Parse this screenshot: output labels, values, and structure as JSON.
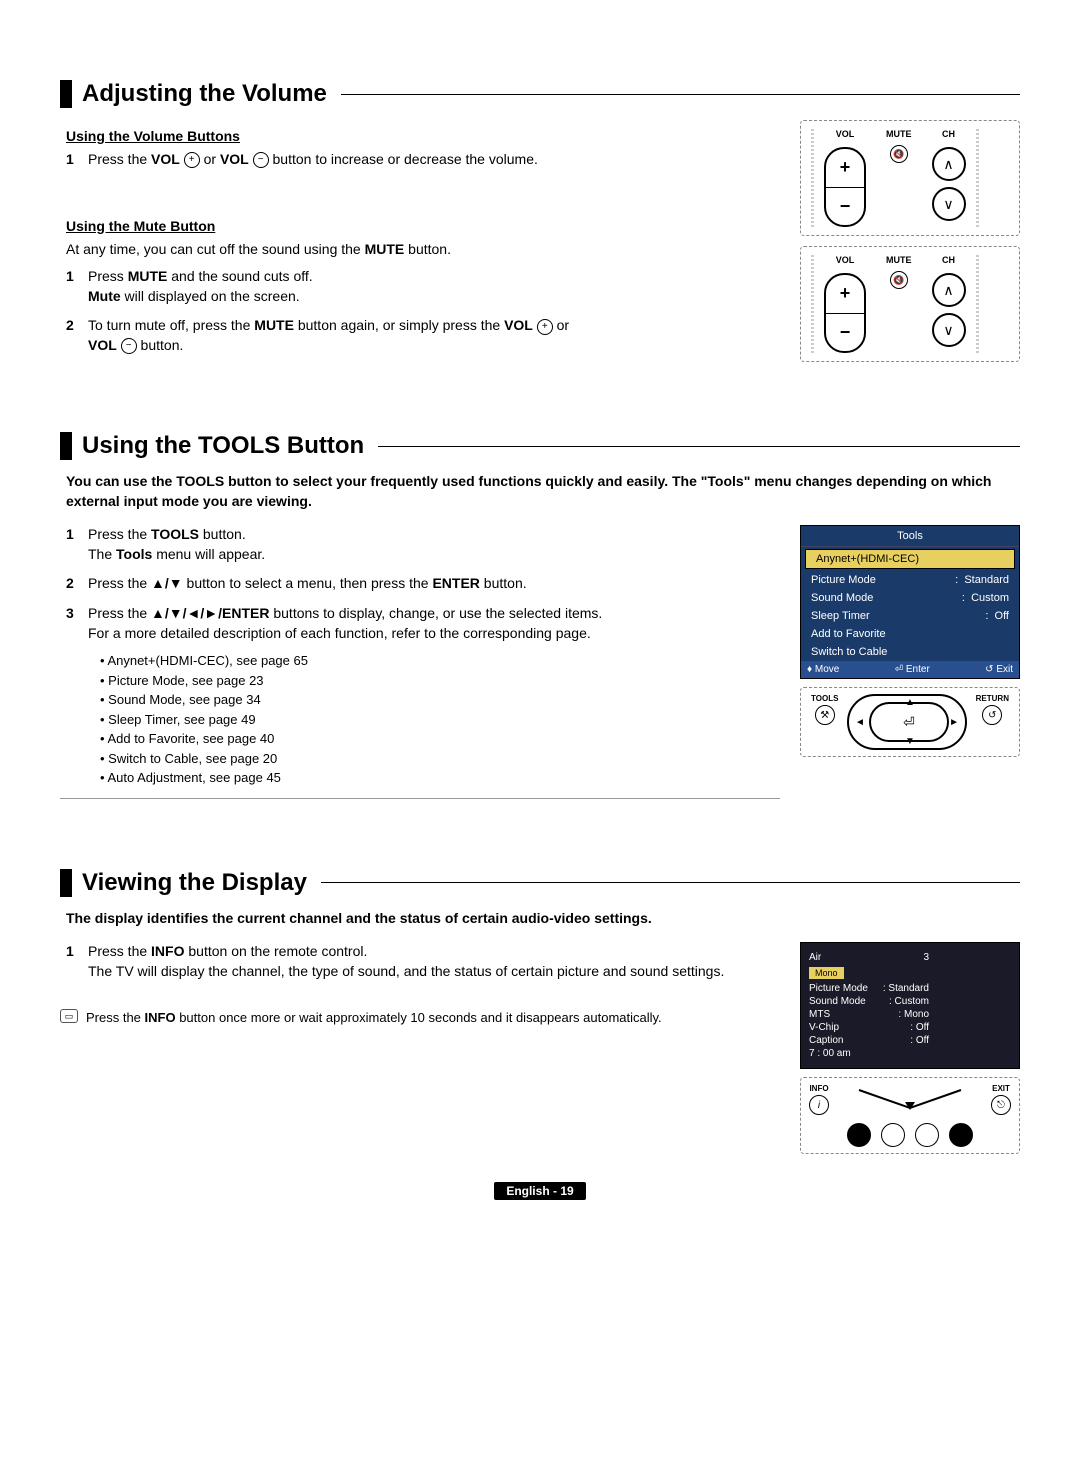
{
  "sections": {
    "volume": {
      "title": "Adjusting the Volume",
      "sub1": "Using the Volume Buttons",
      "step1_pre": "Press the ",
      "step1_b1": "VOL",
      "step1_mid": " or ",
      "step1_b2": "VOL",
      "step1_post": " button to increase or decrease the volume.",
      "sub2": "Using the Mute Button",
      "mute_intro_pre": "At any time, you can cut off the sound using the ",
      "mute_intro_b": "MUTE",
      "mute_intro_post": " button.",
      "m1_pre": "Press ",
      "m1_b": "MUTE",
      "m1_mid": " and the sound cuts off.",
      "m1_line2_b": "Mute",
      "m1_line2": " will displayed on the screen.",
      "m2_pre": "To turn mute off, press the ",
      "m2_b1": "MUTE",
      "m2_mid": " button again, or simply press the ",
      "m2_b2": "VOL",
      "m2_or": " or ",
      "m2_b3": "VOL",
      "m2_post": " button.",
      "fig": {
        "vol": "VOL",
        "ch": "CH",
        "mute": "MUTE"
      }
    },
    "tools": {
      "title": "Using the TOOLS Button",
      "intro": "You can use the TOOLS button to select your frequently used functions quickly and easily. The \"Tools\" menu changes depending on which external input mode you are viewing.",
      "s1_pre": "Press the ",
      "s1_b": "TOOLS",
      "s1_post": " button.",
      "s1_line2_pre": "The ",
      "s1_line2_b": "Tools",
      "s1_line2_post": " menu will appear.",
      "s2_pre": "Press the ",
      "s2_b": "▲/▼",
      "s2_mid": " button to select a menu, then press the ",
      "s2_b2": "ENTER",
      "s2_post": " button.",
      "s3_pre": "Press the ",
      "s3_b": "▲/▼/◄/►/ENTER",
      "s3_post": " buttons to display, change, or use the selected items.",
      "s3_line2": "For a more detailed description of each function, refer to the corresponding page.",
      "bullets": [
        "• Anynet+(HDMI-CEC), see page 65",
        "• Picture Mode, see page 23",
        "• Sound Mode, see page 34",
        "• Sleep Timer, see page 49",
        "• Add to Favorite, see page 40",
        "• Switch to Cable, see page 20",
        "• Auto Adjustment, see page 45"
      ],
      "osd": {
        "title": "Tools",
        "selected": "Anynet+(HDMI-CEC)",
        "rows": [
          {
            "l": "Picture Mode",
            "r": "Standard"
          },
          {
            "l": "Sound Mode",
            "r": "Custom"
          },
          {
            "l": "Sleep Timer",
            "r": "Off"
          },
          {
            "l": "Add to Favorite",
            "r": ""
          },
          {
            "l": "Switch to Cable",
            "r": ""
          }
        ],
        "move": "Move",
        "enter": "Enter",
        "exit": "Exit"
      },
      "dpad": {
        "tools": "TOOLS",
        "return": "RETURN"
      }
    },
    "display": {
      "title": "Viewing the Display",
      "intro": "The display identifies the current channel and the status of certain audio-video settings.",
      "s1_pre": "Press the ",
      "s1_b": "INFO",
      "s1_post": " button on the remote control.",
      "s1_line2": "The TV will display the channel, the type of sound, and the status of certain picture and sound settings.",
      "note_pre": "Press the ",
      "note_b": "INFO",
      "note_post": " button once more or wait approximately 10 seconds and it disappears automatically.",
      "osd": {
        "air": "Air",
        "ch": "3",
        "mono": "Mono",
        "rows": [
          {
            "l": "Picture Mode",
            "r": "Standard"
          },
          {
            "l": "Sound Mode",
            "r": "Custom"
          },
          {
            "l": "MTS",
            "r": "Mono"
          },
          {
            "l": "V-Chip",
            "r": "Off"
          },
          {
            "l": "Caption",
            "r": "Off"
          }
        ],
        "time": "7 : 00 am"
      },
      "remote": {
        "info": "INFO",
        "exit": "EXIT"
      }
    }
  },
  "nums": {
    "n1": "1",
    "n2": "2",
    "n3": "3"
  },
  "icons": {
    "plus": "+",
    "minus": "−",
    "up": "∧",
    "down": "∨"
  },
  "footer": "English - 19"
}
